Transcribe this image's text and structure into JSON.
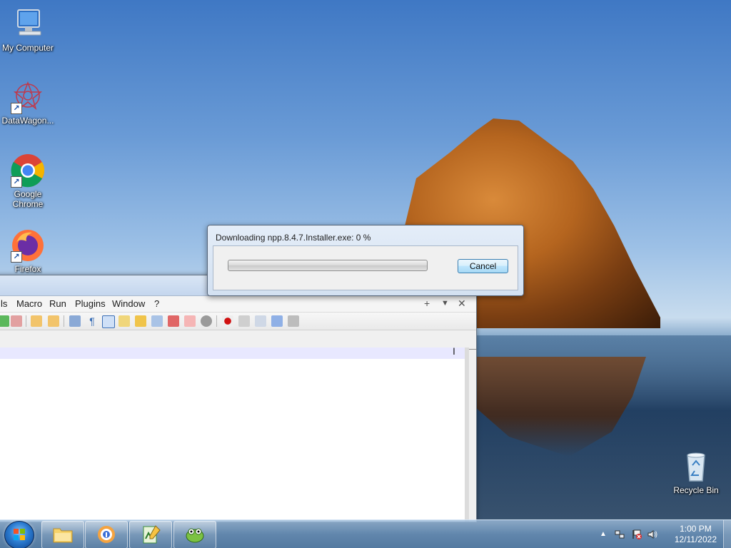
{
  "desktop": {
    "icons": [
      {
        "label": "My Computer",
        "icon": "computer-icon"
      },
      {
        "label": "DataWagon...",
        "icon": "datawagon-icon"
      },
      {
        "label": "Google Chrome",
        "icon": "chrome-icon"
      },
      {
        "label": "Firefox",
        "icon": "firefox-icon"
      },
      {
        "label": "Recycle Bin",
        "icon": "recycle-bin-icon"
      }
    ]
  },
  "dialog": {
    "title": "Downloading npp.8.4.7.Installer.exe: 0 %",
    "progress_percent": 0,
    "cancel_label": "Cancel"
  },
  "npp": {
    "menu": {
      "items": [
        "ls",
        "Macro",
        "Run",
        "Plugins",
        "Window",
        "?"
      ],
      "controls": [
        "+",
        "▼",
        "✕"
      ]
    }
  },
  "taskbar": {
    "buttons": [
      {
        "icon": "folder-icon"
      },
      {
        "icon": "browser-icon"
      },
      {
        "icon": "notepad-icon"
      },
      {
        "icon": "notepadpp-icon"
      }
    ],
    "tray_icons": [
      "show-hidden-icons-icon",
      "network-icon",
      "action-center-icon",
      "volume-icon"
    ],
    "clock": {
      "time": "1:00 PM",
      "date": "12/11/2022"
    }
  }
}
